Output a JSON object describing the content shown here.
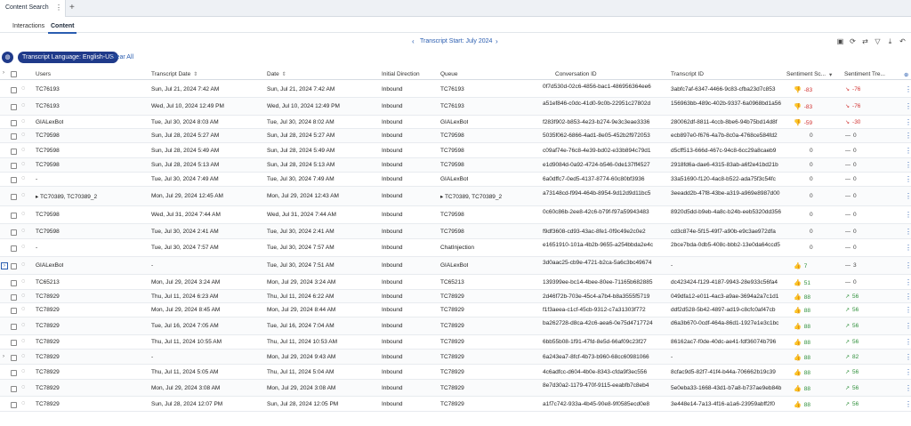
{
  "tabbar": {
    "title": "Content Search",
    "menu_glyph": "⋮",
    "add_glyph": "+"
  },
  "subtabs": [
    {
      "label": "Interactions",
      "active": false
    },
    {
      "label": "Content",
      "active": true
    }
  ],
  "date_nav": {
    "label": "Transcript Start: July 2024"
  },
  "filters": {
    "chip": "Transcript Language: English-US",
    "clear_all": "Clear All"
  },
  "columns": {
    "users": "Users",
    "transcript_date": "Transcript Date",
    "date": "Date",
    "initial_direction": "Initial Direction",
    "queue": "Queue",
    "conversation_id": "Conversation ID",
    "transcript_id": "Transcript ID",
    "sentiment_score": "Sentiment Sc...",
    "sentiment_trend": "Sentiment Tre..."
  },
  "colors": {
    "accent": "#2a5db0",
    "chip": "#1f3a8a",
    "negative": "#d0302f",
    "positive": "#2f8f3a"
  },
  "rows": [
    {
      "users": "TC76193",
      "tdate": "Sun, Jul 21, 2024 7:42 AM",
      "date": "Sun, Jul 21, 2024 7:42 AM",
      "dir": "Inbound",
      "queue": "TC76193",
      "conv": "0f7d530d-02c6-4856-bac1-486956364ee6",
      "trans": "3abfc7af-6347-4466-9c83-cfba23d7c853",
      "score": "-83",
      "stype": "neg",
      "trend": "-76",
      "ttype": "neg",
      "h": 19
    },
    {
      "users": "TC76193",
      "tdate": "Wed, Jul 10, 2024 12:49 PM",
      "date": "Wed, Jul 10, 2024 12:49 PM",
      "dir": "Inbound",
      "queue": "TC76193",
      "conv": "a51ef846-c0dc-41d0-9c0b-22951c27802d",
      "trans": "156963bb-489c-402b-9337-6a0968bd1a56",
      "score": "-83",
      "stype": "neg",
      "trend": "-76",
      "ttype": "neg",
      "h": 20
    },
    {
      "users": "GIALexBot",
      "tdate": "Tue, Jul 30, 2024 8:03 AM",
      "date": "Tue, Jul 30, 2024 8:02 AM",
      "dir": "Inbound",
      "queue": "GIALexBot",
      "conv": "f283f902-b853-4e23-b274-9e3c3eae3336",
      "trans": "280062df-8811-4ccb-8be6-94b75bd14d8f",
      "score": "-59",
      "stype": "neg",
      "trend": "-30",
      "ttype": "neg",
      "h": 15
    },
    {
      "users": "TC79598",
      "tdate": "Sun, Jul 28, 2024 5:27 AM",
      "date": "Sun, Jul 28, 2024 5:27 AM",
      "dir": "Inbound",
      "queue": "TC79598",
      "conv": "5035f062-6866-4ad1-8e05-452b2f972053",
      "trans": "ecb897e0-f676-4a7b-8c0a-4768ce584fd2",
      "score": "0",
      "stype": "neu",
      "trend": "0",
      "ttype": "neu",
      "h": 16
    },
    {
      "users": "TC79598",
      "tdate": "Sun, Jul 28, 2024 5:49 AM",
      "date": "Sun, Jul 28, 2024 5:49 AM",
      "dir": "Inbound",
      "queue": "TC79598",
      "conv": "c09af74e-76c8-4e39-bd02-e33b894c79d1",
      "trans": "d5cff513-666d-467c-94c8-6cc29a8caeb9",
      "score": "0",
      "stype": "neu",
      "trend": "0",
      "ttype": "neu",
      "h": 17
    },
    {
      "users": "TC79598",
      "tdate": "Sun, Jul 28, 2024 5:13 AM",
      "date": "Sun, Jul 28, 2024 5:13 AM",
      "dir": "Inbound",
      "queue": "TC79598",
      "conv": "e1d9084d-0a92-4724-b546-0de137ff4527",
      "trans": "2918fd6a-dae6-4315-83ab-a6f2e41bd21b",
      "score": "0",
      "stype": "neu",
      "trend": "0",
      "ttype": "neu",
      "h": 16
    },
    {
      "users": "-",
      "tdate": "Tue, Jul 30, 2024 7:49 AM",
      "date": "Tue, Jul 30, 2024 7:49 AM",
      "dir": "Inbound",
      "queue": "GIALexBot",
      "conv": "6a0dffc7-0ed5-4137-8774-60c80bf3936",
      "trans": "33a51690-f120-4ac8-b522-ada75f3c54fc",
      "score": "0",
      "stype": "neu",
      "trend": "0",
      "ttype": "neu",
      "h": 16
    },
    {
      "users": "TC70389, TC70389_2",
      "tdate": "Mon, Jul 29, 2024 12:45 AM",
      "date": "Mon, Jul 29, 2024 12:43 AM",
      "dir": "Inbound",
      "queue": "TC70389, TC70389_2",
      "conv": "a73148cd-f994-464b-8954-9d12d9d11bc5",
      "trans": "3eeadd2b-47f8-43be-a319-a969e8987d00",
      "score": "0",
      "stype": "neu",
      "trend": "0",
      "ttype": "neu",
      "h": 22,
      "multi": true
    },
    {
      "users": "TC79598",
      "tdate": "Wed, Jul 31, 2024 7:44 AM",
      "date": "Wed, Jul 31, 2024 7:44 AM",
      "dir": "Inbound",
      "queue": "TC79598",
      "conv": "0c60c86b-2ee8-42c6-b79f-f97a59943483",
      "trans": "8920d5dd-b9eb-4a8c-b24b-eeb5320dd356",
      "score": "0",
      "stype": "neu",
      "trend": "0",
      "ttype": "neu",
      "h": 20
    },
    {
      "users": "TC79598",
      "tdate": "Tue, Jul 30, 2024 2:41 AM",
      "date": "Tue, Jul 30, 2024 2:41 AM",
      "dir": "Inbound",
      "queue": "TC79598",
      "conv": "f9df3608-cd93-43ac-8fe1-0f9c49e2c0e2",
      "trans": "cd3c874e-5f15-49f7-a90b-e9c3ae972dfa",
      "score": "0",
      "stype": "neu",
      "trend": "0",
      "ttype": "neu",
      "h": 17
    },
    {
      "users": "-",
      "tdate": "Tue, Jul 30, 2024 7:57 AM",
      "date": "Tue, Jul 30, 2024 7:57 AM",
      "dir": "Inbound",
      "queue": "ChatInjection",
      "conv": "e1651910-101a-4b2b-9655-a254bbda2e4c",
      "trans": "2bce7bda-0db5-408c-bbb2-13e0da64ccd5",
      "score": "0",
      "stype": "neu",
      "trend": "0",
      "ttype": "neu",
      "h": 20
    },
    {
      "users": "GIALexBot",
      "tdate": "-",
      "date": "Tue, Jul 30, 2024 7:51 AM",
      "dir": "Inbound",
      "queue": "GIALexBot",
      "conv": "3d0aac25-cb9e-4721-b2ca-5a6c3bc49674",
      "trans": "-",
      "score": "7",
      "stype": "pos",
      "trend": "3",
      "ttype": "neu",
      "h": 20,
      "boxed": true
    },
    {
      "users": "TC65213",
      "tdate": "Mon, Jul 29, 2024 3:24 AM",
      "date": "Mon, Jul 29, 2024 3:24 AM",
      "dir": "Inbound",
      "queue": "TC65213",
      "conv": "139399ee-bc14-4bee-80ee-71165b682885",
      "trans": "dc423424-f129-4187-9943-28e933c56fa4",
      "score": "51",
      "stype": "pos",
      "trend": "0",
      "ttype": "neu",
      "h": 17
    },
    {
      "users": "TC78929",
      "tdate": "Thu, Jul 11, 2024 6:23 AM",
      "date": "Thu, Jul 11, 2024 6:22 AM",
      "dir": "Inbound",
      "queue": "TC78929",
      "conv": "2d46f72b-703e-45c4-a7b4-b8a3555f5719",
      "trans": "049dfa12-e011-4ac3-a9ae-3694a2a7c1d1",
      "score": "88",
      "stype": "pos",
      "trend": "56",
      "ttype": "pos",
      "h": 15
    },
    {
      "users": "TC78929",
      "tdate": "Mon, Jul 29, 2024 8:45 AM",
      "date": "Mon, Jul 29, 2024 8:44 AM",
      "dir": "Inbound",
      "queue": "TC78929",
      "conv": "f1f3aeea-c1cf-45cb-9312-c7a31303f772",
      "trans": "ddf2d528-5b42-4897-ad19-c8cfc0af47cb",
      "score": "88",
      "stype": "pos",
      "trend": "56",
      "ttype": "pos",
      "h": 16
    },
    {
      "users": "TC78929",
      "tdate": "Tue, Jul 16, 2024 7:05 AM",
      "date": "Tue, Jul 16, 2024 7:04 AM",
      "dir": "Inbound",
      "queue": "TC78929",
      "conv": "ba262728-d8ca-42c6-aea6-0e75d4717724",
      "trans": "d6a3b670-0cdf-464a-86d1-1927e1e3c1bc",
      "score": "88",
      "stype": "pos",
      "trend": "56",
      "ttype": "pos",
      "h": 20
    },
    {
      "users": "TC78929",
      "tdate": "Thu, Jul 11, 2024 10:55 AM",
      "date": "Thu, Jul 11, 2024 10:53 AM",
      "dir": "Inbound",
      "queue": "TC78929",
      "conv": "6bb55b08-1f91-47fd-8e5d-66af09c23f27",
      "trans": "86162ac7-f0de-40dc-ae41-fdf36074b796",
      "score": "88",
      "stype": "pos",
      "trend": "56",
      "ttype": "pos",
      "h": 16
    },
    {
      "users": "TC78929",
      "tdate": "-",
      "date": "Mon, Jul 29, 2024 9:43 AM",
      "dir": "Inbound",
      "queue": "TC78929",
      "conv": "6a243ea7-8fcf-4b73-b960-68cc60981066",
      "trans": "-",
      "score": "88",
      "stype": "pos",
      "trend": "82",
      "ttype": "pos",
      "h": 17,
      "arrow": true
    },
    {
      "users": "TC78929",
      "tdate": "Thu, Jul 11, 2024 5:05 AM",
      "date": "Thu, Jul 11, 2024 5:04 AM",
      "dir": "Inbound",
      "queue": "TC78929",
      "conv": "4c6adfcc-d604-4b0e-8343-cfda9f3ec556",
      "trans": "8cfac9d5-82f7-41f4-b44a-706662b19c39",
      "score": "88",
      "stype": "pos",
      "trend": "56",
      "ttype": "pos",
      "h": 17
    },
    {
      "users": "TC78929",
      "tdate": "Mon, Jul 29, 2024 3:08 AM",
      "date": "Mon, Jul 29, 2024 3:08 AM",
      "dir": "Inbound",
      "queue": "TC78929",
      "conv": "8e7d30a2-1179-470f-9115-eeabfb7c8eb4",
      "trans": "5e0eba33-1668-43d1-b7a8-b737ae9eb84b",
      "score": "88",
      "stype": "pos",
      "trend": "56",
      "ttype": "pos",
      "h": 19
    },
    {
      "users": "TC78929",
      "tdate": "Sun, Jul 28, 2024 12:07 PM",
      "date": "Sun, Jul 28, 2024 12:05 PM",
      "dir": "Inbound",
      "queue": "TC78929",
      "conv": "a1f7c742-933a-4b45-90e8-9f0585ecd0e8",
      "trans": "3e448e14-7a13-4f16-a1a6-23959abff2f0",
      "score": "88",
      "stype": "pos",
      "trend": "56",
      "ttype": "pos",
      "h": 17
    }
  ]
}
